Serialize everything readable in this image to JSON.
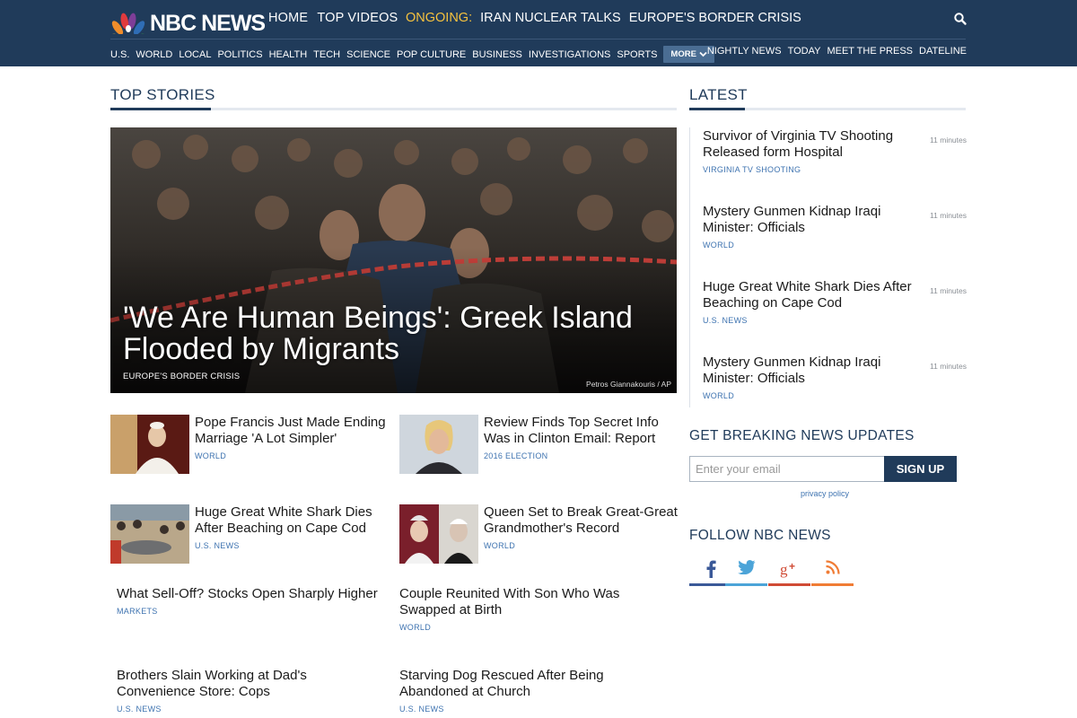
{
  "header": {
    "logo_text": "NBC NEWS",
    "top_nav": [
      "HOME",
      "TOP VIDEOS"
    ],
    "ongoing_label": "ONGOING:",
    "ongoing_links": [
      "IRAN NUCLEAR TALKS",
      "EUROPE'S BORDER CRISIS"
    ],
    "sections": [
      "U.S.",
      "WORLD",
      "LOCAL",
      "POLITICS",
      "HEALTH",
      "TECH",
      "SCIENCE",
      "POP CULTURE",
      "BUSINESS",
      "INVESTIGATIONS",
      "SPORTS"
    ],
    "more_label": "MORE",
    "shows": [
      "NIGHTLY NEWS",
      "TODAY",
      "MEET THE PRESS",
      "DATELINE"
    ]
  },
  "top_stories": {
    "heading": "TOP STORIES",
    "hero": {
      "title": "'We Are Human Beings': Greek Island Flooded by Migrants",
      "tag": "EUROPE'S BORDER CRISIS",
      "credit": "Petros Giannakouris / AP"
    },
    "stories": [
      {
        "title": "Pope Francis Just Made Ending Marriage 'A Lot Simpler'",
        "tag": "WORLD"
      },
      {
        "title": "Review Finds Top Secret Info Was in Clinton Email: Report",
        "tag": "2016 ELECTION"
      },
      {
        "title": "Huge Great White Shark Dies After Beaching on Cape Cod",
        "tag": "U.S. NEWS"
      },
      {
        "title": "Queen Set to Break Great-Great Grandmother's Record",
        "tag": "WORLD"
      },
      {
        "title": "What Sell-Off? Stocks Open Sharply Higher",
        "tag": "MARKETS"
      },
      {
        "title": "Couple Reunited With Son Who Was Swapped at Birth",
        "tag": "WORLD"
      },
      {
        "title": "Brothers Slain Working at Dad's Convenience Store: Cops",
        "tag": "U.S. NEWS"
      },
      {
        "title": "Starving Dog Rescued After Being Abandoned at Church",
        "tag": "U.S. NEWS"
      }
    ]
  },
  "latest": {
    "heading": "LATEST",
    "items": [
      {
        "title": "Survivor of Virginia TV Shooting Released form Hospital",
        "tag": "VIRGINIA TV SHOOTING",
        "time": "11 minutes"
      },
      {
        "title": "Mystery Gunmen Kidnap Iraqi Minister: Officials",
        "tag": "WORLD",
        "time": "11 minutes"
      },
      {
        "title": "Huge Great White Shark Dies After Beaching on Cape Cod",
        "tag": "U.S. NEWS",
        "time": "11 minutes"
      },
      {
        "title": "Mystery Gunmen Kidnap Iraqi Minister: Officials",
        "tag": "WORLD",
        "time": "11 minutes"
      }
    ]
  },
  "breaking": {
    "heading": "GET BREAKING NEWS UPDATES",
    "email_placeholder": "Enter your email",
    "signup_label": "SIGN UP",
    "privacy_label": "privacy policy"
  },
  "follow": {
    "heading": "FOLLOW NBC NEWS",
    "networks": [
      {
        "icon": "facebook-icon",
        "color": "#3b5998"
      },
      {
        "icon": "twitter-icon",
        "color": "#4ca4d8"
      },
      {
        "icon": "google-plus-icon",
        "color": "#d04b35"
      },
      {
        "icon": "rss-icon",
        "color": "#f07c35"
      }
    ]
  },
  "colors": {
    "brand_navy": "#203b5a",
    "ongoing_yellow": "#f6c23e",
    "tag_blue": "#3e73b0"
  }
}
